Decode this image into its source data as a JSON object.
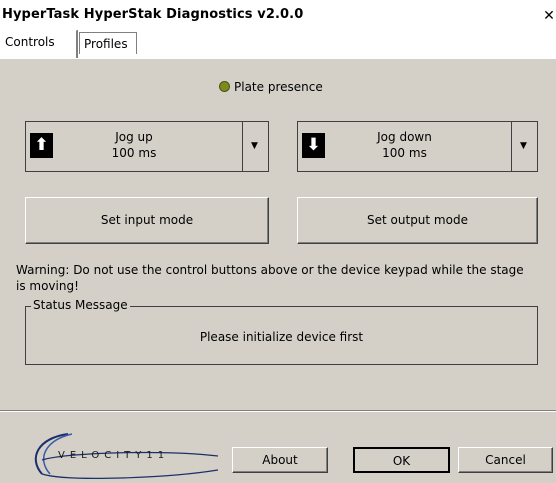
{
  "window": {
    "title": "HyperTask HyperStak Diagnostics v2.0.0",
    "close_glyph": "✕"
  },
  "tabs": [
    {
      "label": "Controls",
      "active": true
    },
    {
      "label": "Profiles",
      "active": false
    }
  ],
  "controls": {
    "plate_presence_label": "Plate presence",
    "jog_up": {
      "line1": "Jog up",
      "line2": "100 ms",
      "icon": "arrow-up-icon"
    },
    "jog_down": {
      "line1": "Jog down",
      "line2": "100 ms",
      "icon": "arrow-down-icon"
    },
    "set_input_mode": "Set input mode",
    "set_output_mode": "Set output mode",
    "warning": "Warning: Do not use the control buttons above or the device keypad while the stage is moving!",
    "status_group_label": "Status Message",
    "status_message": "Please initialize device first"
  },
  "footer": {
    "logo_text": "VELOCITY11",
    "about_label": "About",
    "ok_label": "OK",
    "cancel_label": "Cancel"
  },
  "colors": {
    "led": "#7c8a1e",
    "face": "#d4d0c8"
  }
}
